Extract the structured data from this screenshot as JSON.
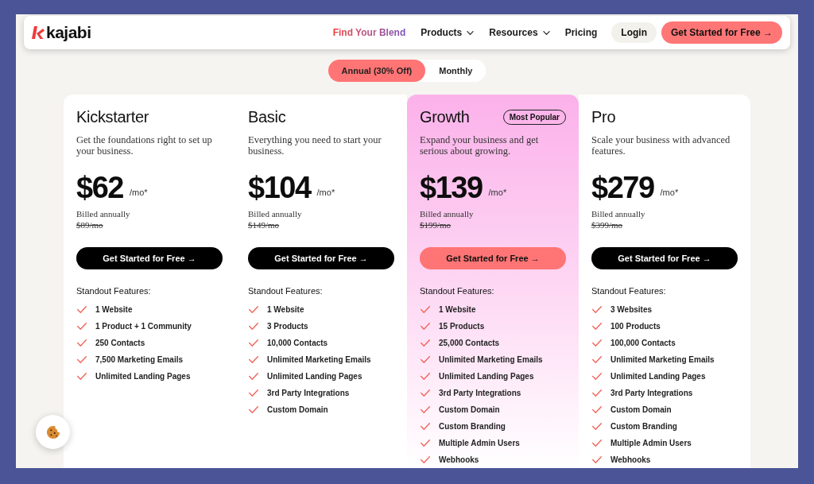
{
  "header": {
    "logo": "kajabi",
    "nav": [
      {
        "label": "Find Your Blend",
        "kind": "highlight"
      },
      {
        "label": "Products",
        "kind": "dropdown"
      },
      {
        "label": "Resources",
        "kind": "dropdown"
      },
      {
        "label": "Pricing",
        "kind": "link"
      }
    ],
    "login": "Login",
    "cta": "Get Started for Free →"
  },
  "billing_toggle": [
    {
      "label": "Annual (30% Off)",
      "selected": true
    },
    {
      "label": "Monthly",
      "selected": false
    }
  ],
  "plans": [
    {
      "name": "Kickstarter",
      "highlighted": false,
      "description": "Get the foundations right to set up your business.",
      "price": "$62",
      "period": "/mo*",
      "billing": "Billed annually",
      "original_price": "$89/mo",
      "button": "Get Started for Free →",
      "features_title": "Standout Features:",
      "features": [
        "1 Website",
        "1 Product + 1 Community",
        "250 Contacts",
        "7,500 Marketing Emails",
        "Unlimited Landing Pages"
      ]
    },
    {
      "name": "Basic",
      "highlighted": false,
      "description": "Everything you need to start your business.",
      "price": "$104",
      "period": "/mo*",
      "billing": "Billed annually",
      "original_price": "$149/mo",
      "button": "Get Started for Free →",
      "features_title": "Standout Features:",
      "features": [
        "1 Website",
        "3 Products",
        "10,000 Contacts",
        "Unlimited Marketing Emails",
        "Unlimited Landing Pages",
        "3rd Party Integrations",
        "Custom Domain"
      ]
    },
    {
      "name": "Growth",
      "highlighted": true,
      "badge": "Most Popular",
      "description": "Expand your business and get serious about growing.",
      "price": "$139",
      "period": "/mo*",
      "billing": "Billed annually",
      "original_price": "$199/mo",
      "button": "Get Started for Free →",
      "features_title": "Standout Features:",
      "features": [
        "1 Website",
        "15 Products",
        "25,000 Contacts",
        "Unlimited Marketing Emails",
        "Unlimited Landing Pages",
        "3rd Party Integrations",
        "Custom Domain",
        "Custom Branding",
        "Multiple Admin Users",
        "Webhooks"
      ]
    },
    {
      "name": "Pro",
      "highlighted": false,
      "description": "Scale your business with advanced features.",
      "price": "$279",
      "period": "/mo*",
      "billing": "Billed annually",
      "original_price": "$399/mo",
      "button": "Get Started for Free →",
      "features_title": "Standout Features:",
      "features": [
        "3 Websites",
        "100 Products",
        "100,000 Contacts",
        "Unlimited Marketing Emails",
        "Unlimited Landing Pages",
        "3rd Party Integrations",
        "Custom Domain",
        "Custom Branding",
        "Multiple Admin Users",
        "Webhooks"
      ]
    }
  ]
}
